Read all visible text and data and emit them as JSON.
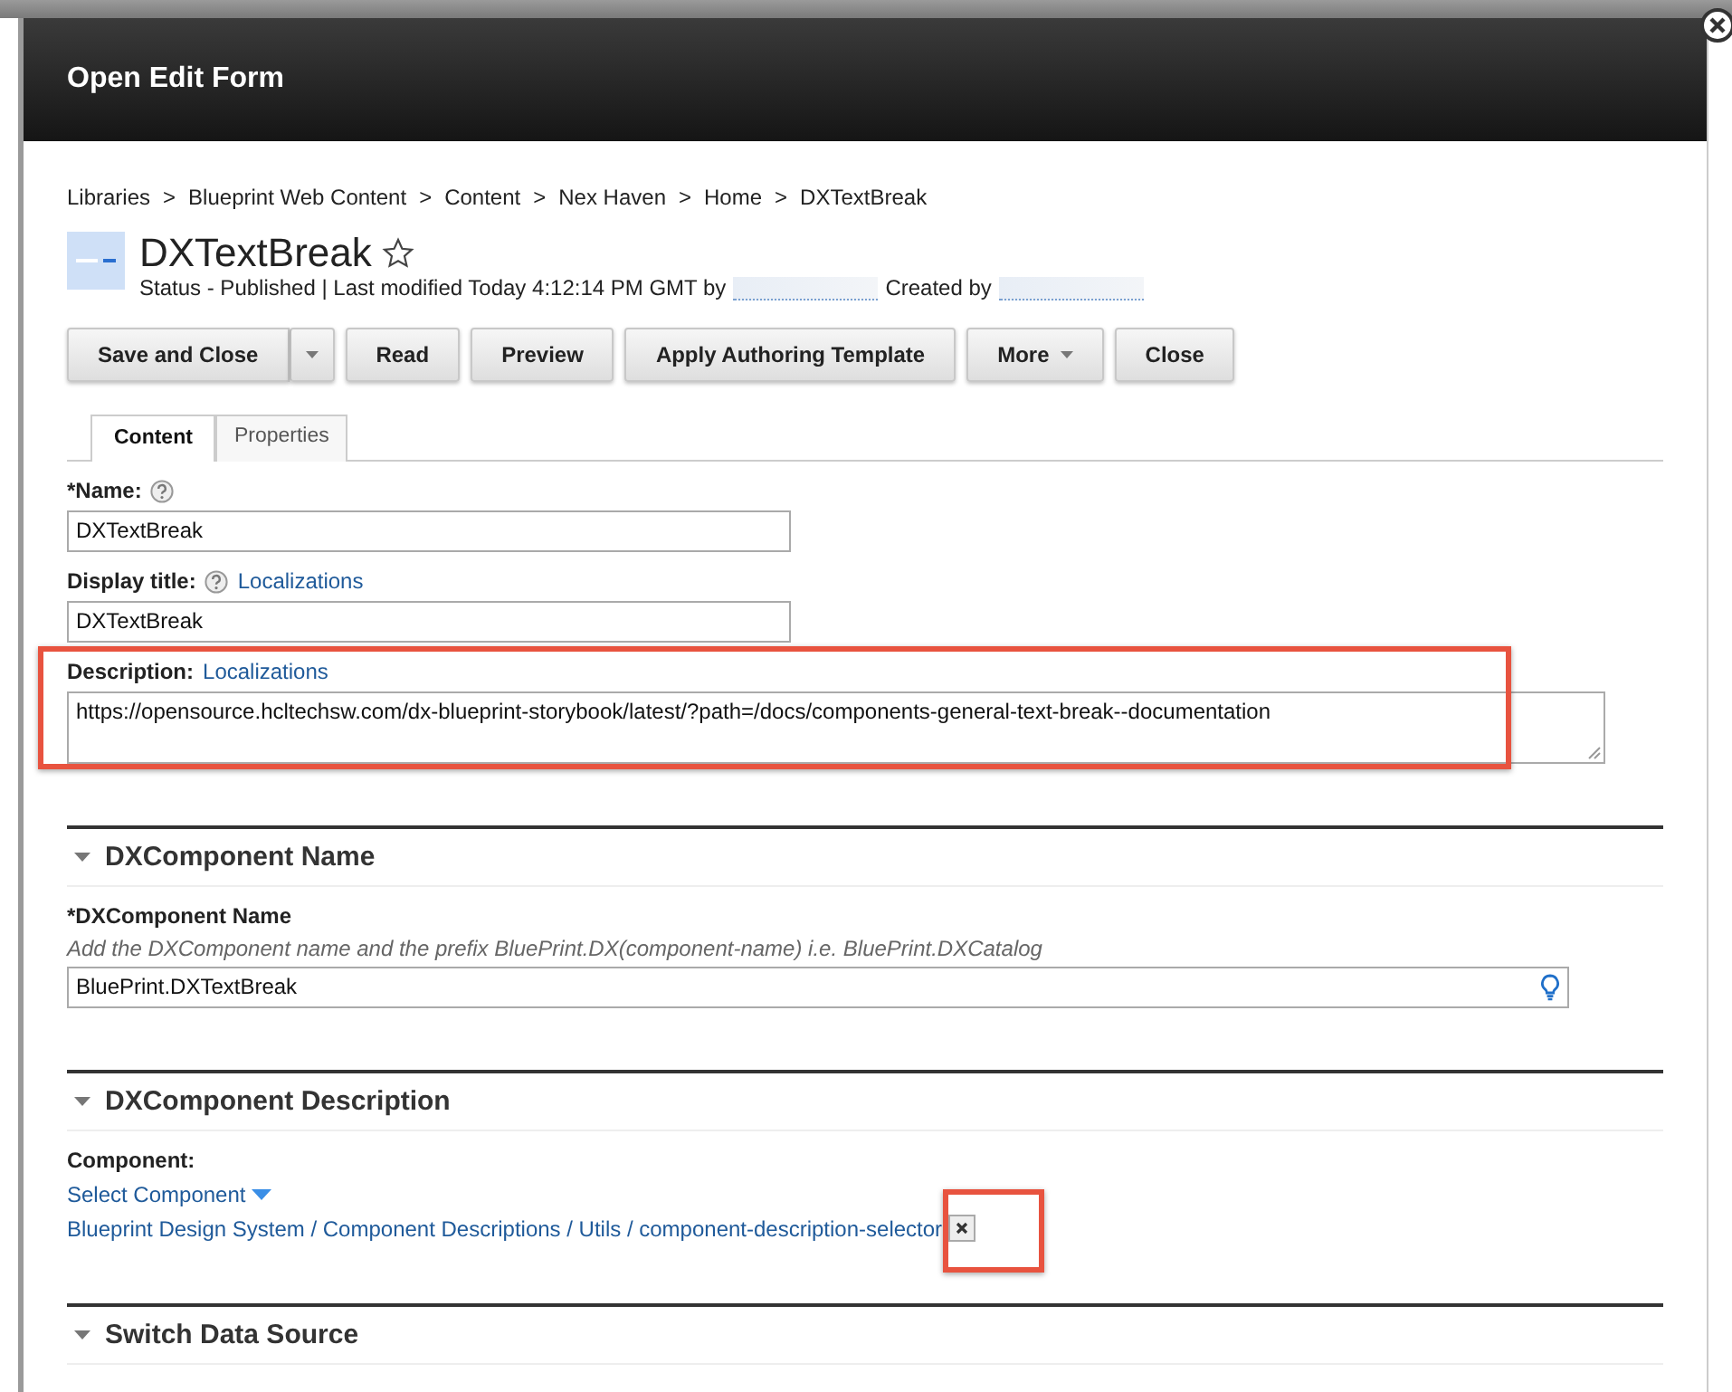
{
  "dialog": {
    "title": "Open Edit Form"
  },
  "breadcrumb": {
    "separator": ">",
    "items": [
      "Libraries",
      "Blueprint Web Content",
      "Content",
      "Nex Haven",
      "Home",
      "DXTextBreak"
    ]
  },
  "item": {
    "title": "DXTextBreak",
    "favorite": false,
    "status": "Status - Published | Last modified Today 4:12:14 PM GMT by",
    "created_label": "Created by"
  },
  "toolbar": [
    {
      "label": "Save and Close",
      "kind": "split"
    },
    {
      "label": "Read",
      "kind": "plain"
    },
    {
      "label": "Preview",
      "kind": "plain"
    },
    {
      "label": "Apply Authoring Template",
      "kind": "plain"
    },
    {
      "label": "More",
      "kind": "menu"
    },
    {
      "label": "Close",
      "kind": "plain"
    }
  ],
  "tabs": [
    {
      "label": "Content",
      "selected": true
    },
    {
      "label": "Properties",
      "selected": false
    }
  ],
  "fields": [
    {
      "kind": "text",
      "label": "*Name:",
      "help": true,
      "value": "DXTextBreak"
    },
    {
      "kind": "text",
      "label": "Display title:",
      "help": true,
      "link": "Localizations",
      "value": "DXTextBreak"
    },
    {
      "kind": "textarea",
      "label": "Description:",
      "link": "Localizations",
      "value": "https://opensource.hcltechsw.com/dx-blueprint-storybook/latest/?path=/docs/components-general-text-break--documentation",
      "highlighted": true
    }
  ],
  "sections": [
    {
      "title": "DXComponent Name",
      "expanded": true,
      "fields": [
        {
          "kind": "hinted",
          "label": "*DXComponent Name",
          "hint": "Add the DXComponent name and the prefix BluePrint.DX(component-name) i.e. BluePrint.DXCatalog",
          "value": "BluePrint.DXTextBreak"
        }
      ]
    },
    {
      "title": "DXComponent Description",
      "expanded": true,
      "fields": [
        {
          "kind": "selector",
          "label": "Component:",
          "action": "Select Component",
          "path": "Blueprint Design System / Component Descriptions / Utils / component-description-selector",
          "highlighted": true
        }
      ]
    },
    {
      "title": "Switch Data Source",
      "expanded": true
    }
  ]
}
